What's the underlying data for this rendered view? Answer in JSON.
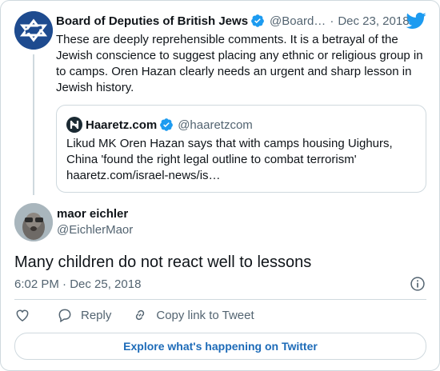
{
  "parent_tweet": {
    "name": "Board of Deputies of British Jews",
    "handle": "@Board…",
    "date": "Dec 23, 2018",
    "text": "These are deeply reprehensible comments. It is a betrayal of the Jewish conscience to suggest placing any ethnic or religious group in to camps. Oren Hazan clearly needs an urgent and sharp lesson in Jewish history.",
    "separator": "·"
  },
  "quoted_tweet": {
    "name": "Haaretz.com",
    "handle": "@haaretzcom",
    "text_line1": "Likud MK Oren Hazan says that with camps housing Uighurs,",
    "text_line2": "China 'found the right legal outline to combat terrorism'",
    "link": "haaretz.com/israel-news/is…"
  },
  "main_tweet": {
    "name": "maor eichler",
    "handle": "@EichlerMaor",
    "text": "Many children do not react well to lessons",
    "timestamp": "6:02 PM · Dec 25, 2018"
  },
  "actions": {
    "reply_label": "Reply",
    "copy_link_label": "Copy link to Tweet"
  },
  "explore_label": "Explore what's happening on Twitter",
  "colors": {
    "accent": "#1d9bf0",
    "border": "#cfd9de",
    "muted": "#536471",
    "link": "#1d6bb8"
  },
  "icons": [
    "twitter-bird-icon",
    "verified-badge-icon",
    "info-icon",
    "heart-icon",
    "reply-icon",
    "link-icon"
  ]
}
